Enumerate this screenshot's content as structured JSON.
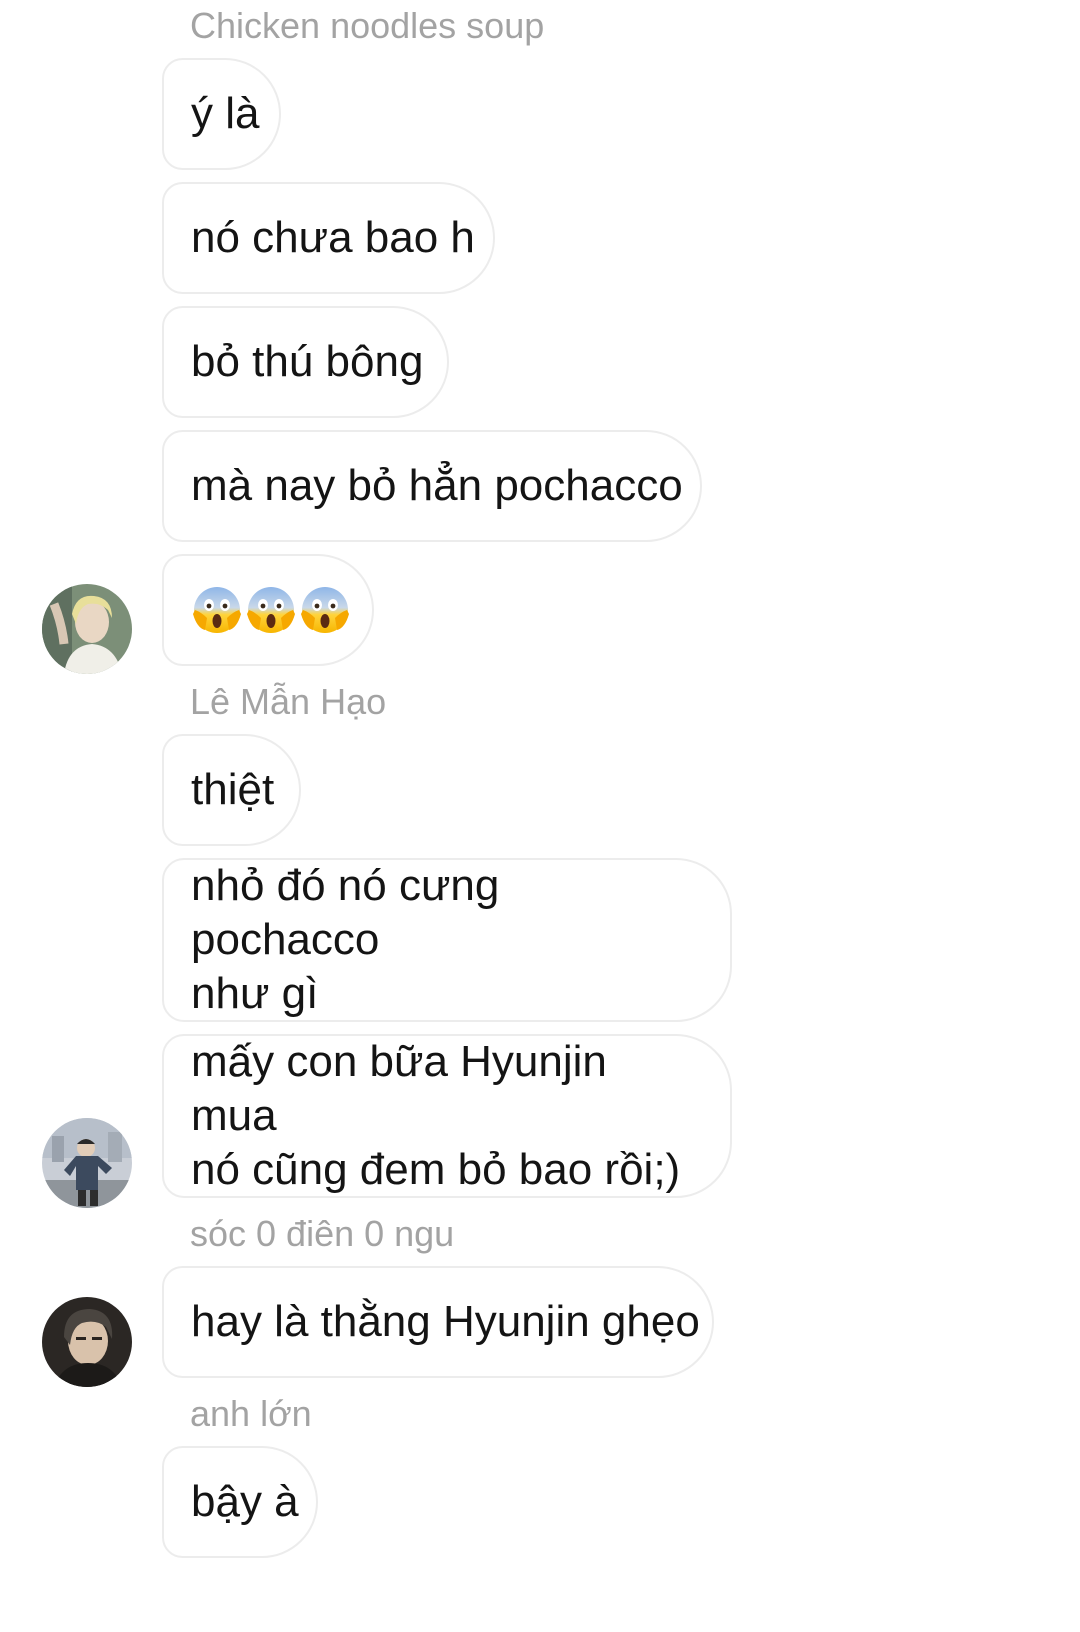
{
  "messages": [
    {
      "sender": "Chicken noodles soup"
    },
    {
      "text": "ý là"
    },
    {
      "text": "nó chưa bao h"
    },
    {
      "text": "bỏ thú bông"
    },
    {
      "text": "mà nay bỏ hẳn pochacco"
    },
    {
      "emojis": [
        "face-screaming-in-fear",
        "face-screaming-in-fear",
        "face-screaming-in-fear"
      ]
    },
    {
      "sender": "Lê Mẫn Hạo"
    },
    {
      "text": "thiệt"
    },
    {
      "text_lines": [
        "nhỏ đó nó cưng pochacco",
        "như gì"
      ]
    },
    {
      "text_lines": [
        "mấy con bữa Hyunjin mua",
        "nó cũng đem bỏ bao rồi;)"
      ]
    },
    {
      "sender": "sóc 0 điên 0 ngu"
    },
    {
      "text": "hay là thằng Hyunjin ghẹo"
    },
    {
      "sender": "anh lớn"
    },
    {
      "text": "bậy à"
    }
  ],
  "colors": {
    "background": "#ffffff",
    "bubble_border": "#ececec",
    "message_text": "#141414",
    "sender_text": "#a3a3a3"
  }
}
